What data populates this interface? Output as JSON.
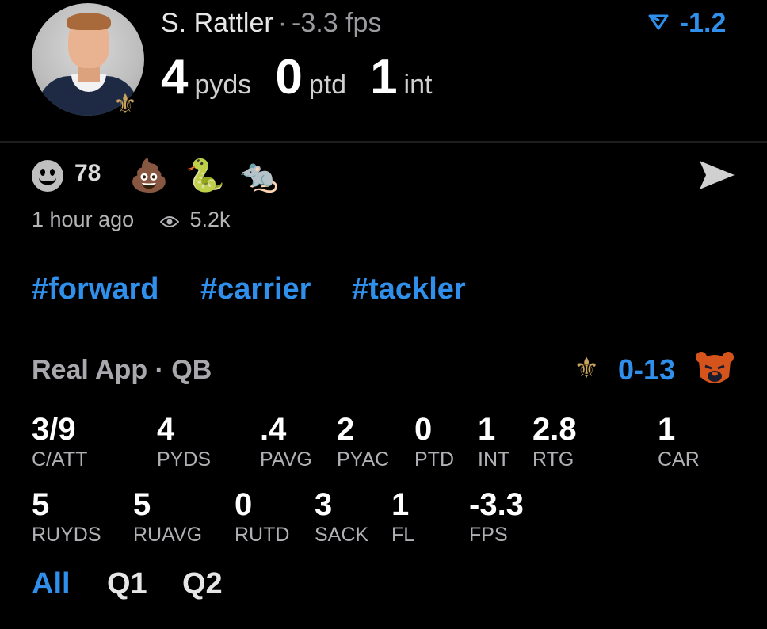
{
  "player": {
    "name": "S. Rattler",
    "separator": "·",
    "fps_text": "-3.3 fps",
    "trend_icon": "down-trend-icon",
    "trend_value": "-1.2",
    "headline": [
      {
        "value": "4",
        "unit": "pyds"
      },
      {
        "value": "0",
        "unit": "ptd"
      },
      {
        "value": "1",
        "unit": "int"
      }
    ]
  },
  "reactions": {
    "smiley_count": "78",
    "emojis": [
      "💩",
      "🐍",
      "🐀"
    ]
  },
  "meta": {
    "time_ago": "1 hour ago",
    "views": "5.2k"
  },
  "hashtags": [
    "#forward",
    "#carrier",
    "#tackler"
  ],
  "game": {
    "section_title": "Real App · QB",
    "score": "0-13",
    "team_badge": "saints-fleur-de-lis-icon",
    "opponent_badge": "bears-logo-icon"
  },
  "stats_row1": [
    {
      "value": "3/9",
      "label": "C/ATT"
    },
    {
      "value": "4",
      "label": "PYDS"
    },
    {
      "value": ".4",
      "label": "PAVG"
    },
    {
      "value": "2",
      "label": "PYAC"
    },
    {
      "value": "0",
      "label": "PTD"
    },
    {
      "value": "1",
      "label": "INT"
    },
    {
      "value": "2.8",
      "label": "RTG"
    },
    {
      "value": "1",
      "label": "CAR"
    }
  ],
  "stats_row2": [
    {
      "value": "5",
      "label": "RUYDS"
    },
    {
      "value": "5",
      "label": "RUAVG"
    },
    {
      "value": "0",
      "label": "RUTD"
    },
    {
      "value": "3",
      "label": "SACK"
    },
    {
      "value": "1",
      "label": "FL"
    },
    {
      "value": "-3.3",
      "label": "FPS"
    }
  ],
  "quarter_tabs": [
    "All",
    "Q1",
    "Q2"
  ],
  "colors": {
    "accent": "#2f8fea",
    "background": "#000000",
    "saints_gold": "#c9a45c",
    "bears_orange": "#d4541c"
  }
}
